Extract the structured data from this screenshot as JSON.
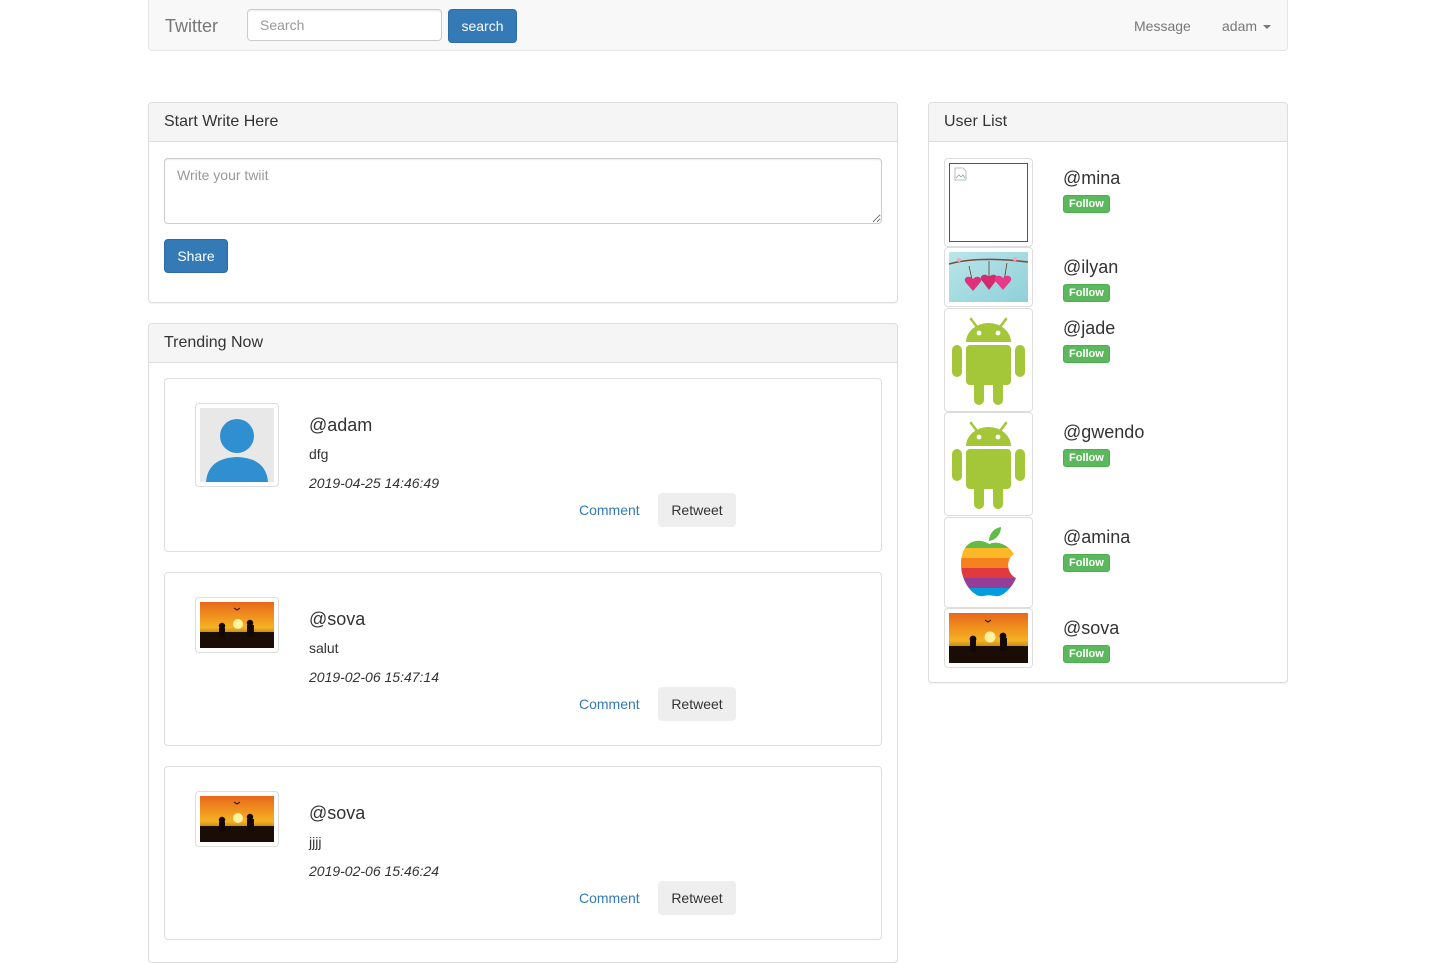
{
  "navbar": {
    "brand": "Twitter",
    "search_placeholder": "Search",
    "search_button": "search",
    "message_link": "Message",
    "user_menu": "adam"
  },
  "compose": {
    "heading": "Start Write Here",
    "placeholder": "Write your twiit",
    "share_button": "Share"
  },
  "trending": {
    "heading": "Trending Now",
    "tweets": [
      {
        "user": "@adam",
        "text": "dfg",
        "time": "2019-04-25 14:46:49",
        "comment": "Comment",
        "retweet": "Retweet",
        "avatar": "default-user-avatar"
      },
      {
        "user": "@sova",
        "text": "salut",
        "time": "2019-02-06 15:47:14",
        "comment": "Comment",
        "retweet": "Retweet",
        "avatar": "sunset-couple-photo"
      },
      {
        "user": "@sova",
        "text": "jjjj",
        "time": "2019-02-06 15:46:24",
        "comment": "Comment",
        "retweet": "Retweet",
        "avatar": "sunset-couple-photo"
      }
    ]
  },
  "user_list": {
    "heading": "User List",
    "users": [
      {
        "name": "@mina",
        "follow": "Follow",
        "avatar": "broken-image"
      },
      {
        "name": "@ilyan",
        "follow": "Follow",
        "avatar": "pink-hearts-photo"
      },
      {
        "name": "@jade",
        "follow": "Follow",
        "avatar": "android-logo"
      },
      {
        "name": "@gwendo",
        "follow": "Follow",
        "avatar": "android-logo"
      },
      {
        "name": "@amina",
        "follow": "Follow",
        "avatar": "rainbow-apple-logo"
      },
      {
        "name": "@sova",
        "follow": "Follow",
        "avatar": "sunset-couple-photo"
      }
    ]
  },
  "colors": {
    "primary": "#337ab7",
    "success": "#5cb85c",
    "android_green": "#a4c639",
    "link": "#337ab7"
  }
}
